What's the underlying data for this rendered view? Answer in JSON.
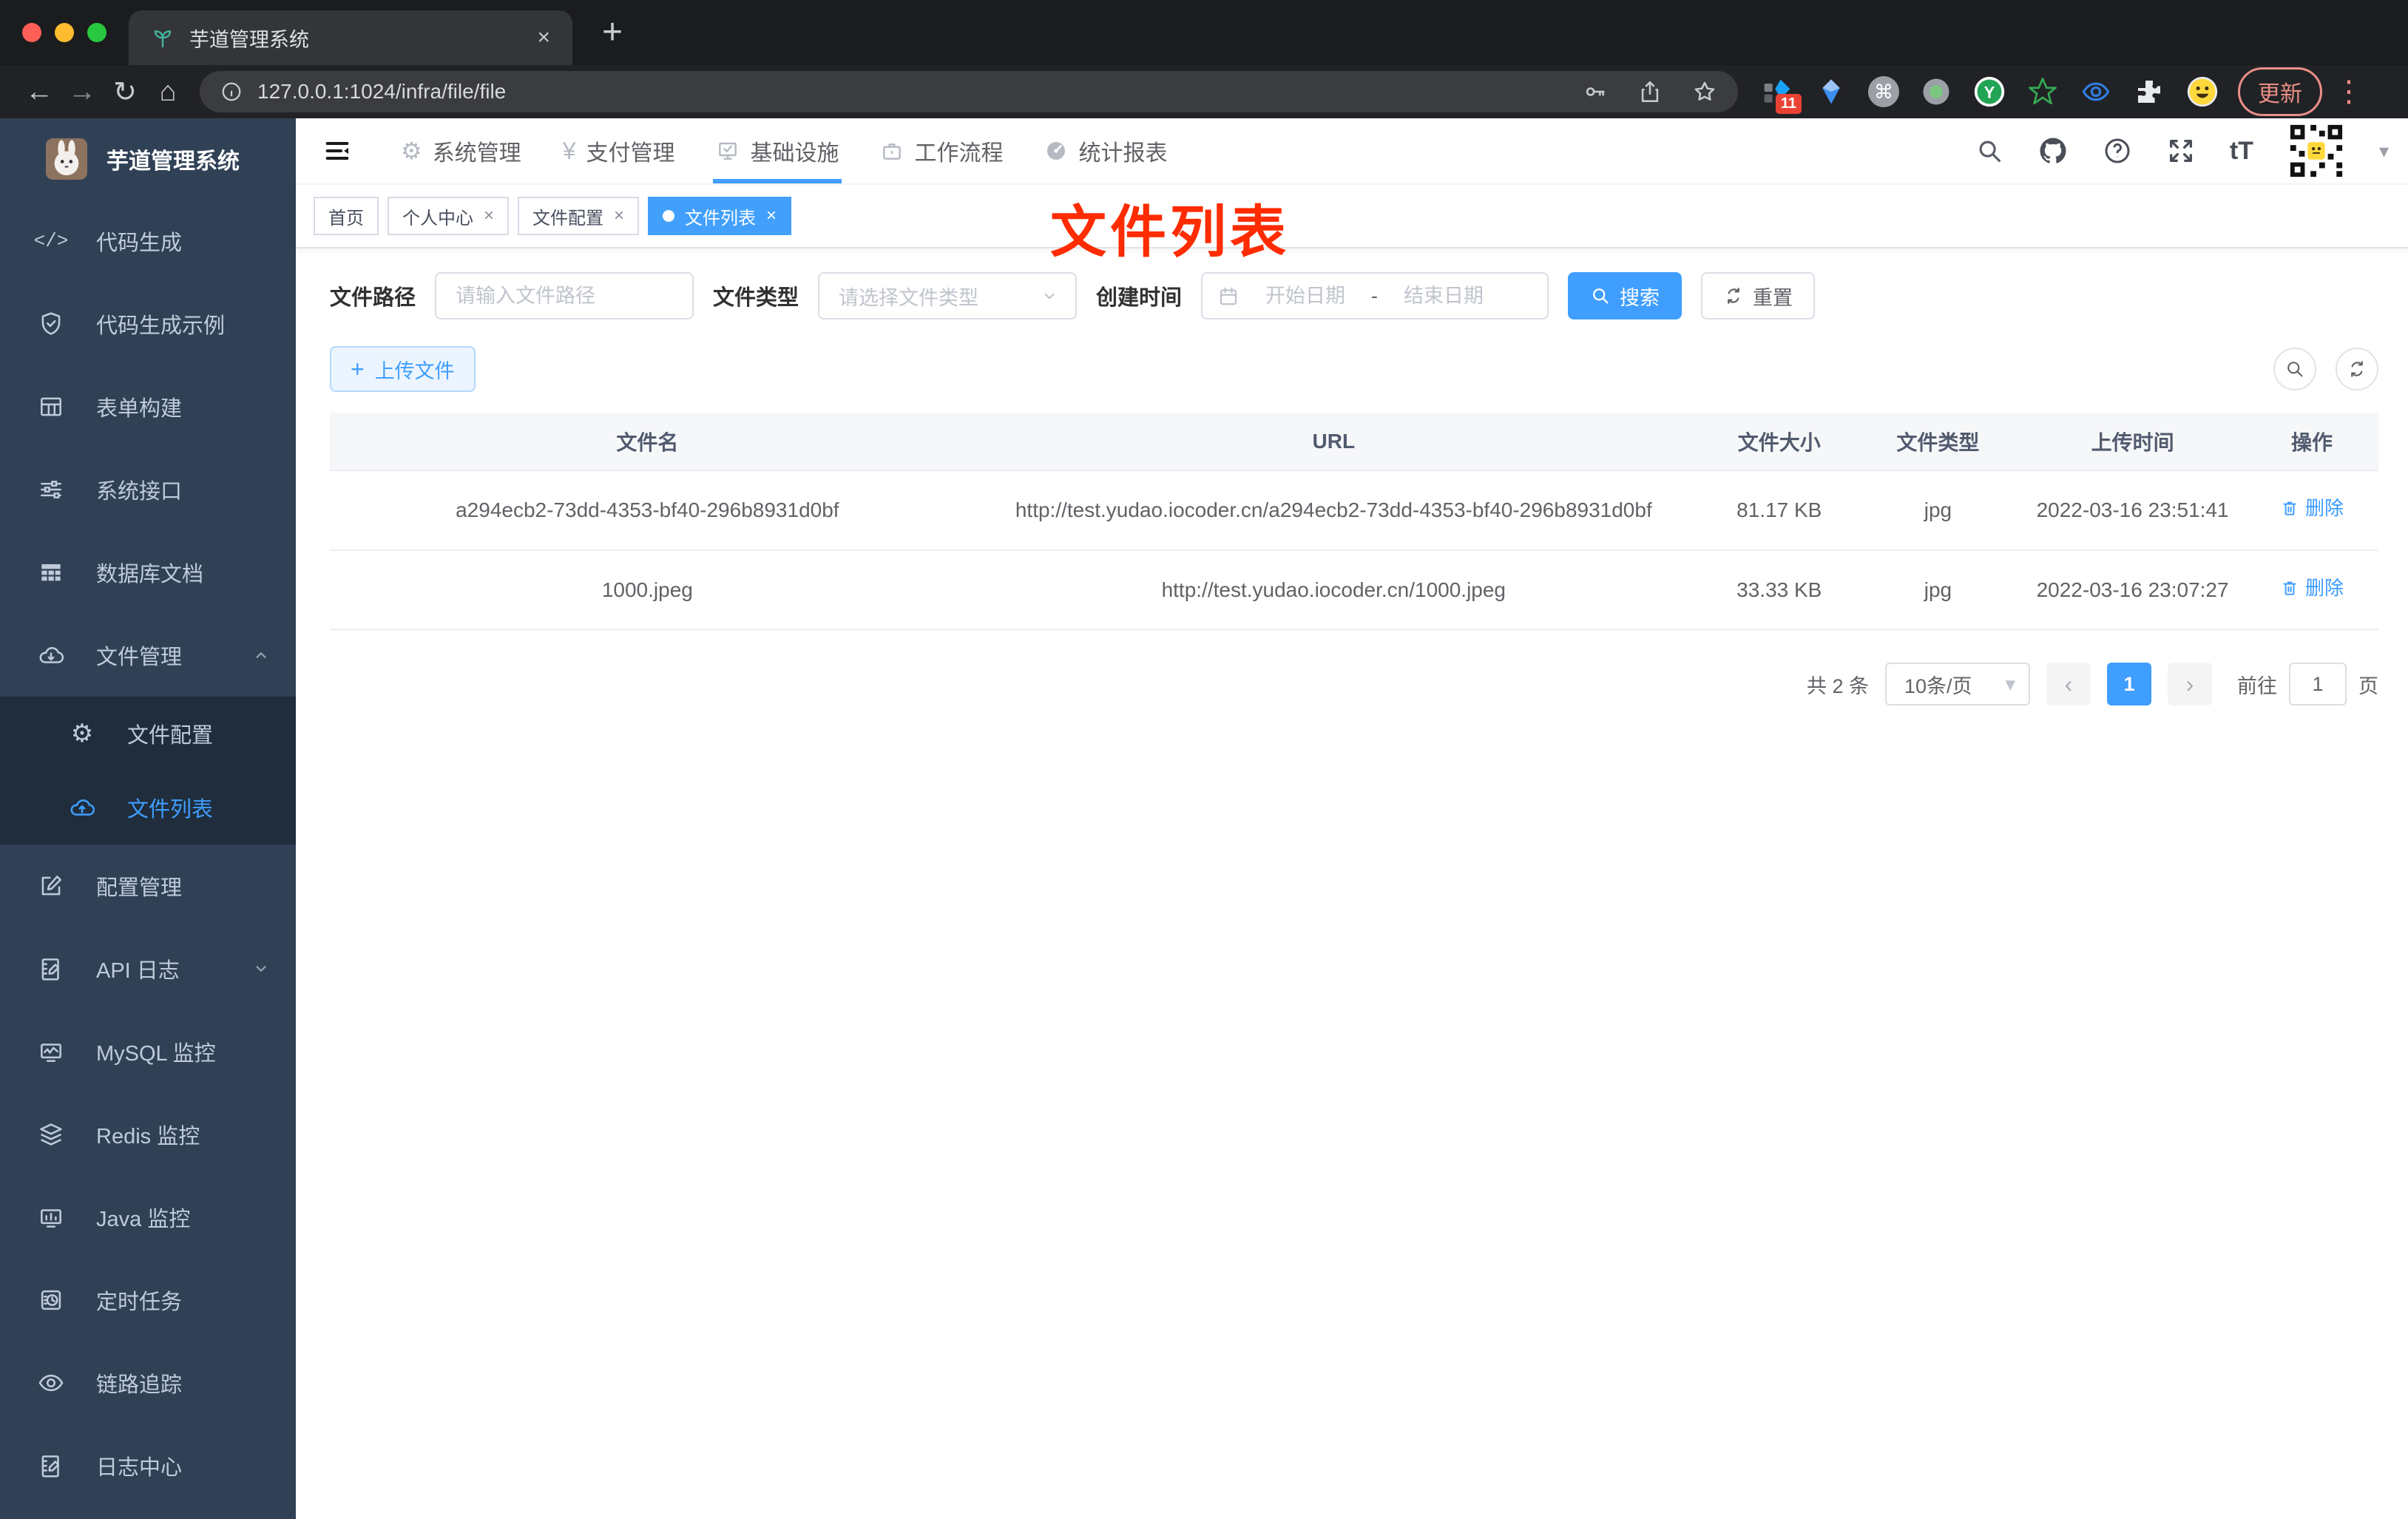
{
  "colors": {
    "accent": "#409eff",
    "active_tag": "#42a0fc",
    "sidebar_bg": "#304156",
    "submenu_bg": "#1f2d3d",
    "annotation_red": "#fe2c00",
    "upload_bg": "#ecf5ff"
  },
  "icons": {
    "close": "×",
    "plus": "+",
    "back": "←",
    "forward": "→",
    "reload": "↻",
    "home": "⌂",
    "command": "⌘",
    "kebab": "⋮",
    "caret_down": "▾",
    "chevron_left": "‹",
    "chevron_right": "›",
    "yen": "¥",
    "gear": "⚙",
    "code": "</>",
    "text_size": "tT",
    "question": "?"
  },
  "browser": {
    "tab_title": "芋道管理系统",
    "url": "127.0.0.1:1024/infra/file/file",
    "extension_badge": "11",
    "update_label": "更新"
  },
  "sidebar": {
    "title": "芋道管理系统",
    "items": [
      {
        "label": "代码生成"
      },
      {
        "label": "代码生成示例"
      },
      {
        "label": "表单构建"
      },
      {
        "label": "系统接口"
      },
      {
        "label": "数据库文档"
      },
      {
        "label": "文件管理"
      },
      {
        "label": "配置管理"
      },
      {
        "label": "API 日志"
      },
      {
        "label": "MySQL 监控"
      },
      {
        "label": "Redis 监控"
      },
      {
        "label": "Java 监控"
      },
      {
        "label": "定时任务"
      },
      {
        "label": "链路追踪"
      },
      {
        "label": "日志中心"
      }
    ],
    "submenu": [
      {
        "label": "文件配置"
      },
      {
        "label": "文件列表"
      }
    ]
  },
  "nav": {
    "items": [
      {
        "label": "系统管理"
      },
      {
        "label": "支付管理"
      },
      {
        "label": "基础设施"
      },
      {
        "label": "工作流程"
      },
      {
        "label": "统计报表"
      }
    ]
  },
  "tags": {
    "items": [
      {
        "label": "首页"
      },
      {
        "label": "个人中心"
      },
      {
        "label": "文件配置"
      },
      {
        "label": "文件列表"
      }
    ]
  },
  "annotation": {
    "text": "文件列表"
  },
  "filters": {
    "path_label": "文件路径",
    "path_placeholder": "请输入文件路径",
    "type_label": "文件类型",
    "type_placeholder": "请选择文件类型",
    "time_label": "创建时间",
    "start_placeholder": "开始日期",
    "separator": "-",
    "end_placeholder": "结束日期",
    "search_label": "搜索",
    "reset_label": "重置"
  },
  "toolbar": {
    "upload_label": "上传文件"
  },
  "table": {
    "headers": [
      "文件名",
      "URL",
      "文件大小",
      "文件类型",
      "上传时间",
      "操作"
    ],
    "rows": [
      {
        "name": "a294ecb2-73dd-4353-bf40-296b8931d0bf",
        "url": "http://test.yudao.iocoder.cn/a294ecb2-73dd-4353-bf40-296b8931d0bf",
        "size": "81.17 KB",
        "type": "jpg",
        "time": "2022-03-16 23:51:41",
        "action": "删除"
      },
      {
        "name": "1000.jpeg",
        "url": "http://test.yudao.iocoder.cn/1000.jpeg",
        "size": "33.33 KB",
        "type": "jpg",
        "time": "2022-03-16 23:07:27",
        "action": "删除"
      }
    ]
  },
  "pagination": {
    "total": "共 2 条",
    "page_size": "10条/页",
    "current_page": "1",
    "goto_label": "前往",
    "goto_value": "1",
    "page_unit": "页"
  }
}
